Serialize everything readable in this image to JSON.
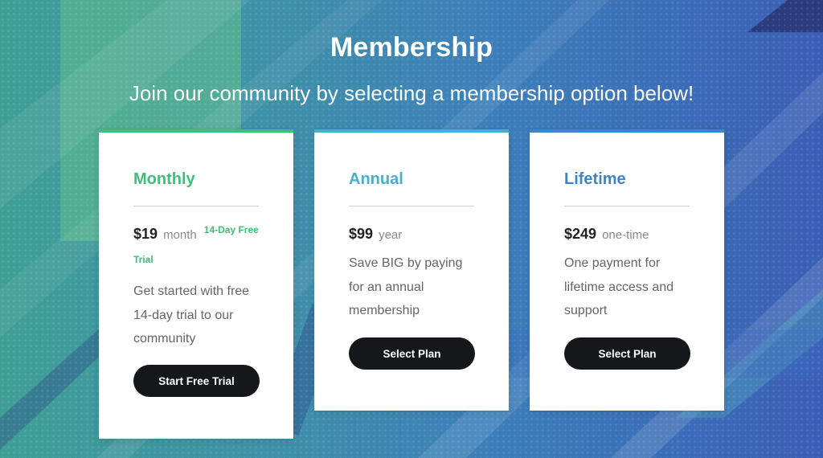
{
  "header": {
    "title": "Membership",
    "subtitle": "Join our community by selecting a membership option below!"
  },
  "plans": [
    {
      "name": "Monthly",
      "accent": "#3fbf7a",
      "price": "$19",
      "unit": "month",
      "trial_badge_a": "14-Day Free",
      "trial_badge_b": "Trial",
      "description": "Get started with free 14-day trial to our community",
      "button": "Start Free Trial"
    },
    {
      "name": "Annual",
      "accent": "#45b0cf",
      "price": "$99",
      "unit": "year",
      "description": "Save BIG by paying for an annual membership",
      "button": "Select Plan"
    },
    {
      "name": "Lifetime",
      "accent": "#3a86c8",
      "price": "$249",
      "unit": "one-time",
      "description": "One payment for lifetime access and support",
      "button": "Select Plan"
    }
  ],
  "colors": {
    "button_bg": "#16171a",
    "background_start": "#3f9f96",
    "background_end": "#3b5fb5"
  }
}
